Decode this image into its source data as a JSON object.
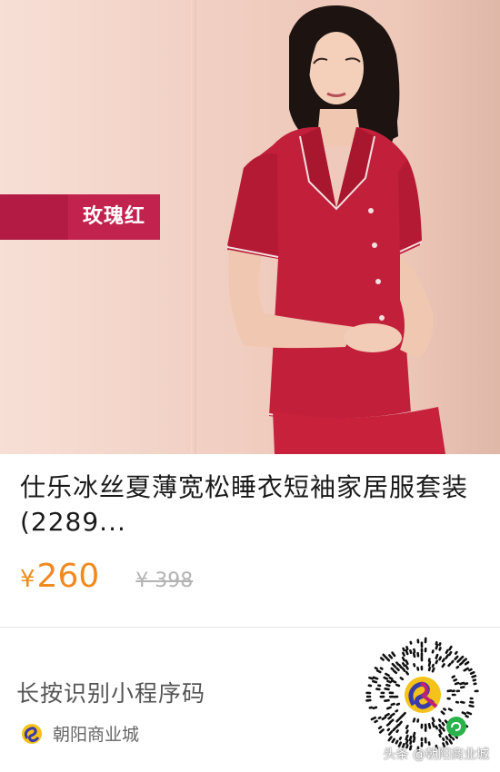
{
  "product": {
    "color_label": "玫瑰红",
    "title": "仕乐冰丝夏薄宽松睡衣短袖家居服套装(2289...",
    "currency": "¥",
    "price": "260",
    "original_price": "¥ 398"
  },
  "footer": {
    "hint": "长按识别小程序码",
    "shop_name": "朝阳商业城",
    "watermark": "头条 @朝阳商业城"
  },
  "colors": {
    "accent": "#f08a1f",
    "tag": "#c2224e",
    "garment": "#c11f3a"
  }
}
